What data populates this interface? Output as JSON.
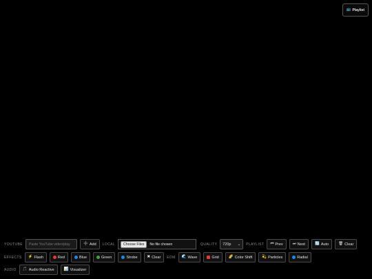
{
  "playlist_button": {
    "icon": "📺",
    "label": "Playlist"
  },
  "youtube": {
    "label": "YOUTUBE",
    "placeholder": "Paste YouTube video/play",
    "add_icon": "➕",
    "add_label": "Add"
  },
  "local": {
    "label": "LOCAL",
    "choose_label": "Choose Files",
    "no_file_text": "No file chosen"
  },
  "quality": {
    "label": "QUALITY",
    "selected": "720p",
    "chevron": "⌄"
  },
  "playlist": {
    "label": "PLAYLIST",
    "prev": {
      "icon": "⏮",
      "label": "Prev"
    },
    "next": {
      "icon": "⏭",
      "label": "Next"
    },
    "auto": {
      "icon": "🔄",
      "label": "Auto"
    },
    "clear": {
      "icon": "🗑",
      "label": "Clear"
    }
  },
  "effects": {
    "label": "EFFECTS",
    "flash": {
      "icon": "⚡",
      "label": "Flash"
    },
    "red": {
      "label": "Red",
      "color": "#e53935"
    },
    "blue": {
      "label": "Blue",
      "color": "#1e88e5"
    },
    "green": {
      "label": "Green",
      "color": "#43a047"
    },
    "strobe": {
      "label": "Strobe",
      "color": "#1e88e5"
    },
    "clear": {
      "icon": "✖",
      "label": "Clear"
    }
  },
  "edm": {
    "label": "EDM",
    "wave": {
      "icon": "🌊",
      "label": "Wave"
    },
    "grid": {
      "label": "Grid",
      "color": "#e53935"
    },
    "color_shift": {
      "icon": "🌈",
      "label": "Color Shift"
    },
    "particles": {
      "icon": "💫",
      "label": "Particles"
    },
    "radial": {
      "label": "Radial",
      "color": "#1e88e5"
    }
  },
  "audio": {
    "label": "AUDIO",
    "reactive": {
      "icon": "🎵",
      "label": "Audio Reactive"
    },
    "visualizer": {
      "icon": "📊",
      "label": "Visualizer"
    }
  }
}
